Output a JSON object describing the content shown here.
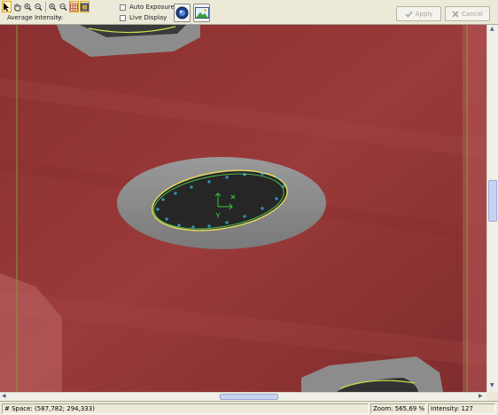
{
  "toolbar": {
    "tools": [
      {
        "name": "pointer-icon",
        "active": true
      },
      {
        "name": "pan-hand-icon",
        "active": false
      },
      {
        "name": "zoom-in-icon",
        "active": false
      },
      {
        "name": "zoom-out-icon",
        "active": false
      },
      {
        "name": "zoom-fit-icon",
        "active": false
      },
      {
        "name": "zoom-actual-icon",
        "active": false
      },
      {
        "name": "grid-overlay-icon",
        "active": true
      },
      {
        "name": "region-overlay-icon",
        "active": true
      }
    ],
    "average_intensity_label": "Average Intensity:",
    "average_intensity_value": "--",
    "auto_exposure_label": "Auto Exposure",
    "auto_exposure_checked": false,
    "live_display_label": "Live Display",
    "live_display_checked": false,
    "camera_button_icon": "camera-icon",
    "image_button_icon": "image-icon",
    "apply_label": "Apply",
    "cancel_label": "Cancel"
  },
  "status": {
    "space": "# Space: (587,782; 294,333)",
    "zoom": "Zoom: 565,69 %",
    "intensity": "Intensity: 127"
  },
  "colors": {
    "overlay_red": "#9e3a3a",
    "dark_red": "#6a2626",
    "hole_dark": "#2a2a2a",
    "halo_gray": "#8a8a8a",
    "guide_line": "#7aa03a",
    "edge_fit": "#f0e24a",
    "edge_contour": "#4ec24e",
    "edge_markers": "#3ab0e0",
    "origin_axes": "#3ac83a"
  }
}
